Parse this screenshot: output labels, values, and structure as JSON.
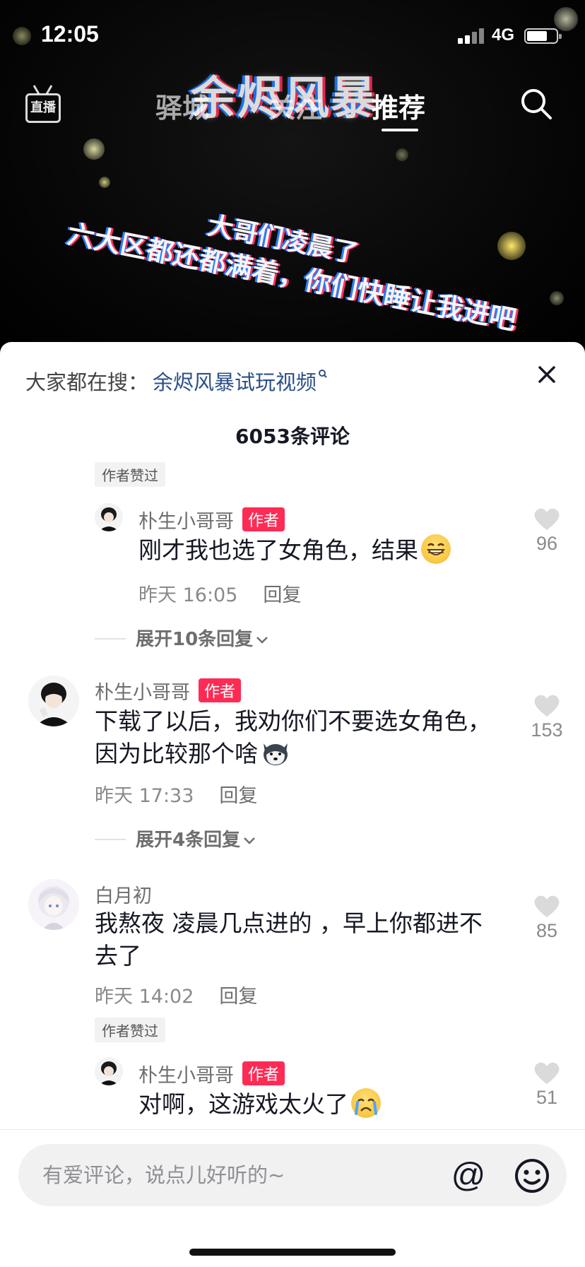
{
  "status_bar": {
    "time": "12:05",
    "network": "4G"
  },
  "video": {
    "title": "余烬风暴",
    "caption_line1": "大哥们凌晨了",
    "caption_line2": "六大区都还都满着，你们快睡让我进吧"
  },
  "top_nav": {
    "live_label": "直播",
    "tabs": [
      {
        "label": "驿城",
        "active": false
      },
      {
        "label": "关注",
        "active": false
      },
      {
        "label": "推荐",
        "active": true
      }
    ]
  },
  "panel": {
    "hot_search_label": "大家都在搜：",
    "hot_search_link": "余烬风暴试玩视频",
    "comment_count": "6053条评论",
    "comments": [
      {
        "liked_badge": "作者赞过",
        "username": "朴生小哥哥",
        "author_tag": "作者",
        "text": "刚才我也选了女角色，结果",
        "time": "昨天 16:05",
        "reply": "回复",
        "likes": "96",
        "expand": "展开10条回复"
      },
      {
        "username": "朴生小哥哥",
        "author_tag": "作者",
        "text_line1": "下载了以后，我劝你们不要选女角色，",
        "text_line2": "因为比较那个啥",
        "time": "昨天 17:33",
        "reply": "回复",
        "likes": "153",
        "expand": "展开4条回复"
      },
      {
        "username": "白月初",
        "text_line1": "我熬夜 凌晨几点进的 ，早上你都进不",
        "text_line2": "去了",
        "time": "昨天 14:02",
        "reply": "回复",
        "likes": "85",
        "liked_badge": "作者赞过"
      },
      {
        "username": "朴生小哥哥",
        "author_tag": "作者",
        "text": "对啊，这游戏太火了",
        "likes": "51"
      }
    ]
  },
  "input_bar": {
    "placeholder": "有爱评论，说点儿好听的~",
    "at_symbol": "@"
  },
  "colors": {
    "author_tag": "#fe2c55",
    "link": "#2b4f8a",
    "meta_text": "#8a8a8a"
  },
  "icons": [
    "live-tv-icon",
    "search-icon",
    "close-icon",
    "heart-icon",
    "chevron-down-icon",
    "at-icon",
    "emoji-icon"
  ]
}
